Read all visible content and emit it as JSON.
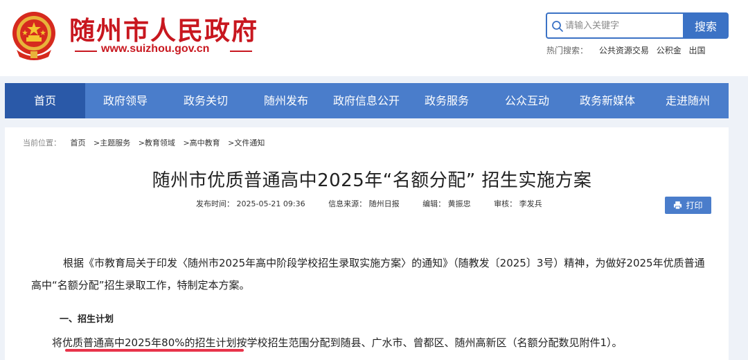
{
  "header": {
    "site_title": "随州市人民政府",
    "site_url": "www.suizhou.gov.cn",
    "brand_color": "#c8171f",
    "search": {
      "placeholder": "请输入关键字",
      "button_label": "搜索",
      "hot_label": "热门搜索：",
      "hot_items": [
        "公共资源交易",
        "公积金",
        "出国"
      ]
    }
  },
  "nav": {
    "items": [
      "首页",
      "政府领导",
      "政务关切",
      "随州发布",
      "政府信息公开",
      "政务服务",
      "公众互动",
      "政务新媒体",
      "走进随州"
    ],
    "active_index": 0,
    "bar_color": "#4a7dcb",
    "active_color": "#2a59a8"
  },
  "article": {
    "breadcrumb_label": "当前位置：",
    "breadcrumb": [
      "首页",
      ">主题服务",
      ">教育领域",
      ">高中教育",
      ">文件通知"
    ],
    "title": "随州市优质普通高中2025年“名额分配” 招生实施方案",
    "meta": {
      "publish_time": "发布时间： 2025-05-21 09:36",
      "source": "信息来源： 随州日报",
      "editor": "编辑： 黄振忠",
      "reviewer": "审核： 李发兵"
    },
    "print_label": "打印",
    "paragraph1": "根据《市教育局关于印发〈随州市2025年高中阶段学校招生录取实施方案〉的通知》（随教发〔2025〕3号）精神，为做好2025年优质普通高中“名额分配”招生录取工作，特制定本方案。",
    "section1_heading": "一、招生计划",
    "paragraph2": "将优质普通高中2025年80%的招生计划按学校招生范围分配到随县、广水市、曾都区、随州高新区（名额分配数见附件1）。",
    "highlight_color": "#e8334a"
  }
}
